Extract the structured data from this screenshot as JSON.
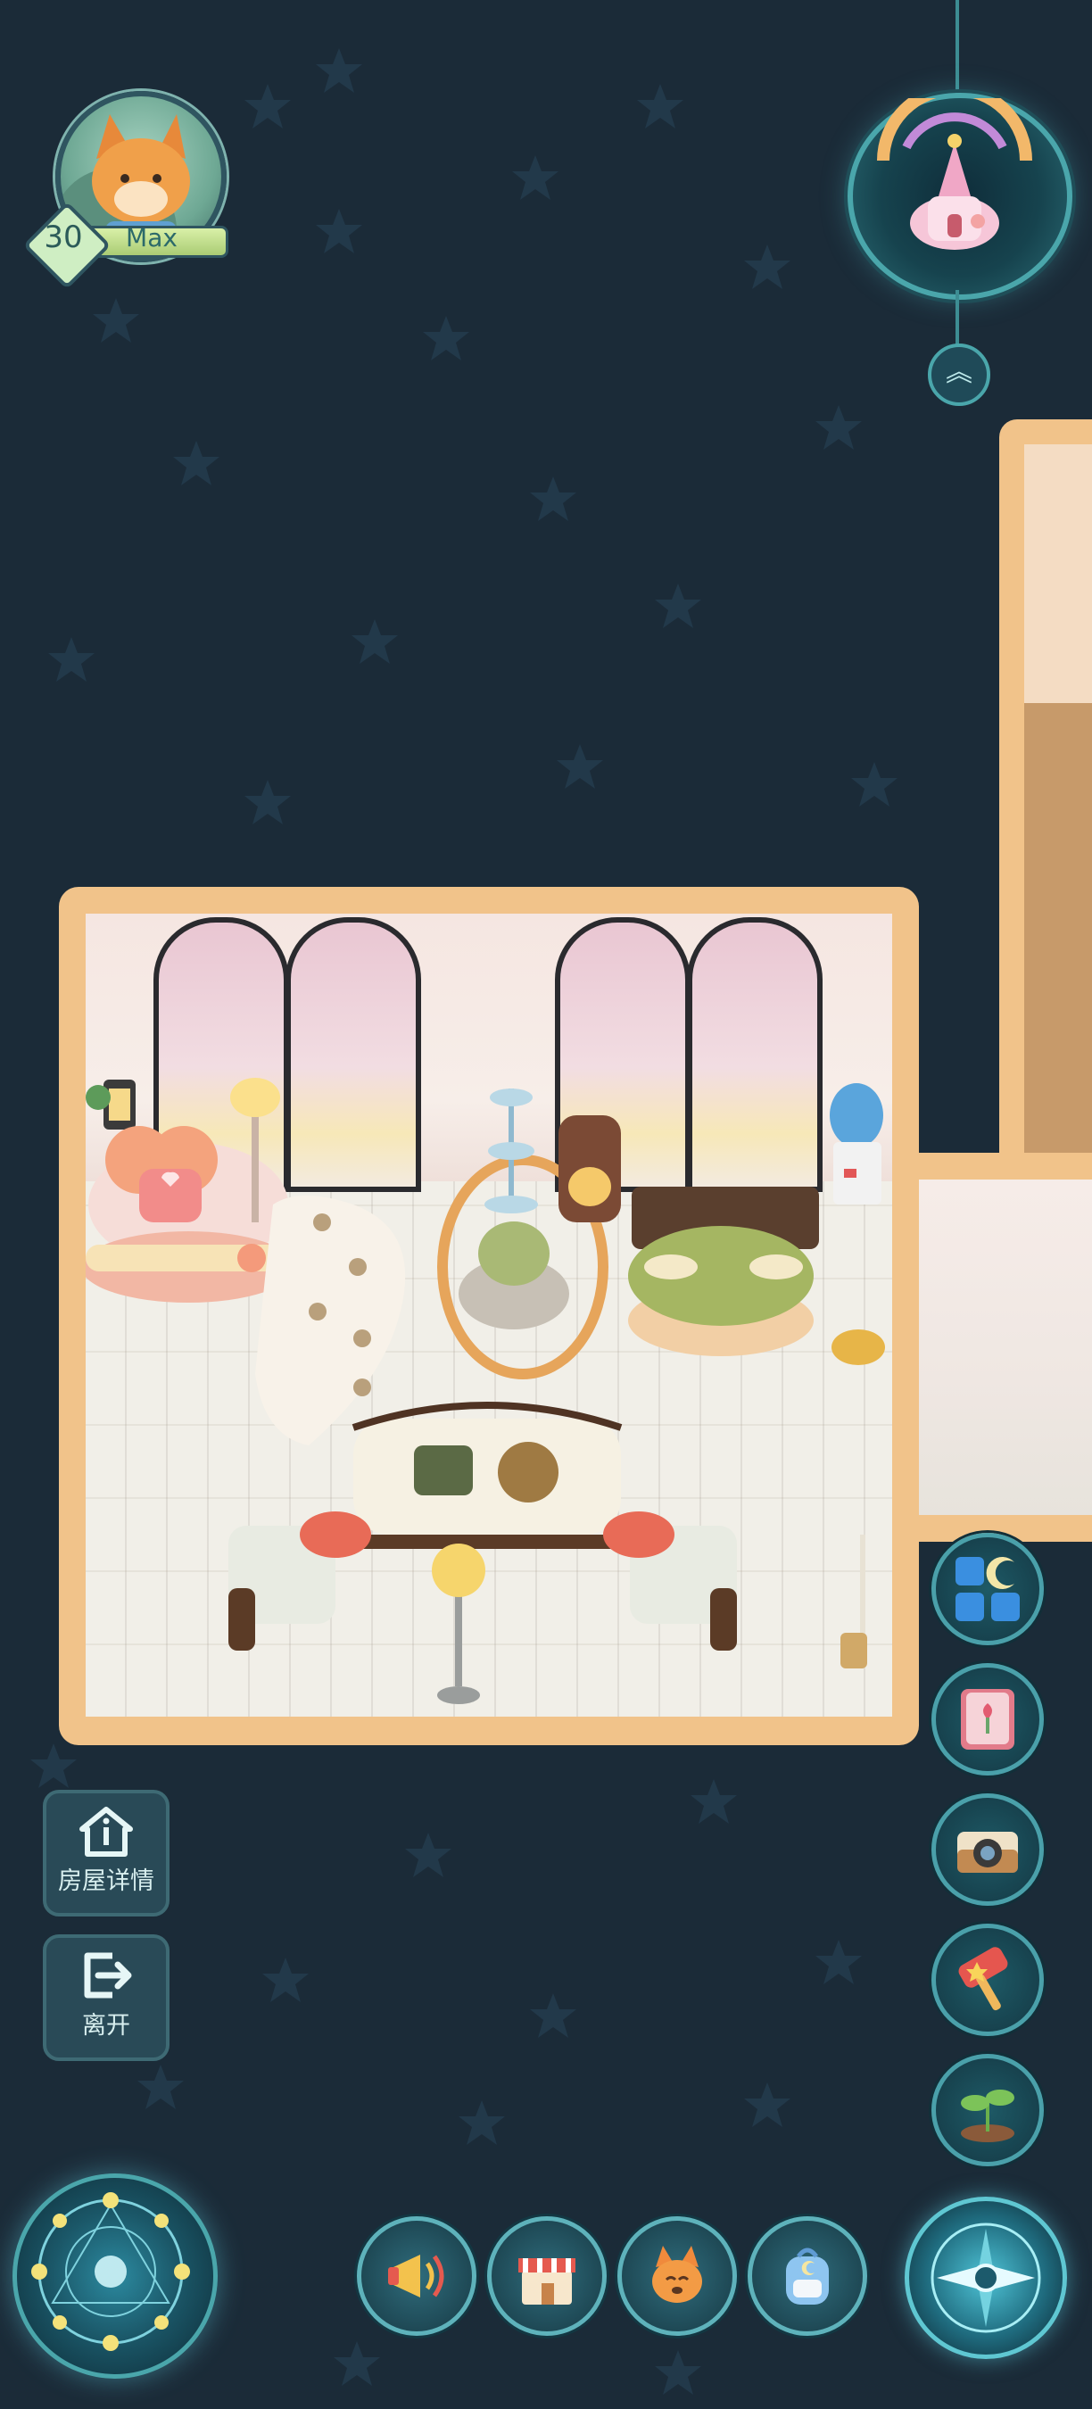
{
  "player": {
    "level": "30",
    "level_max_label": "Max"
  },
  "house_actions": {
    "details_label": "房屋详情",
    "leave_label": "离开"
  },
  "side_menu": [
    "furniture-catalog",
    "guestbook",
    "camera",
    "hammer-build",
    "sprout-planting"
  ],
  "dock": [
    "megaphone",
    "shop",
    "fox-friend",
    "backpack"
  ],
  "colors": {
    "background": "#1b2b38",
    "room_border": "#f1c38a",
    "button_ring": "#4aa0aa"
  }
}
